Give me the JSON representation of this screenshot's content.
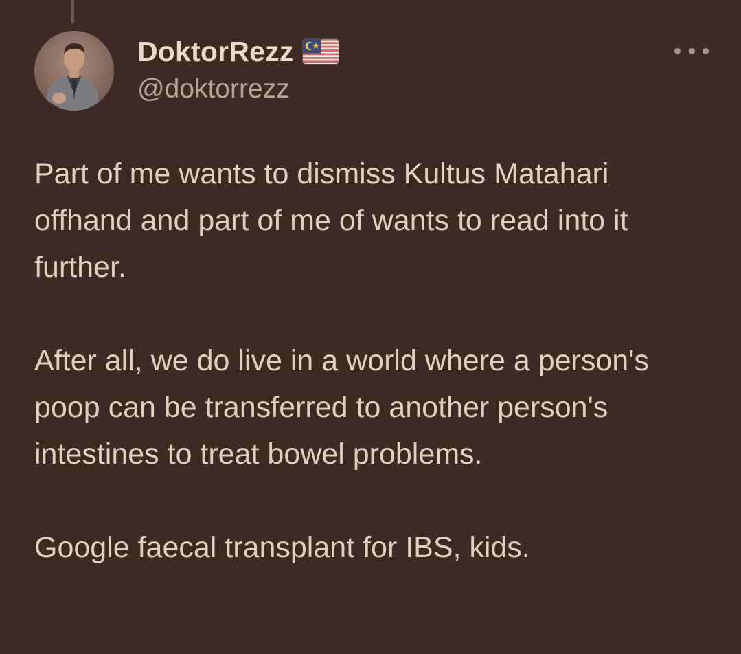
{
  "author": {
    "display_name": "DoktorRezz",
    "handle": "@doktorrezz",
    "flag_icon": "malaysia-flag-icon",
    "avatar_icon": "profile-avatar"
  },
  "actions": {
    "more_icon": "more-horizontal-icon"
  },
  "tweet": {
    "paragraphs": [
      "Part of me wants to dismiss Kultus Matahari offhand and part of me of wants to read into it further.",
      "After all, we do live in a world where a person's poop can be transferred to another person's intestines to treat bowel problems.",
      "Google faecal transplant for IBS, kids."
    ]
  },
  "colors": {
    "background": "#3e2a25",
    "text": "#e5cdbf",
    "secondary_text": "#b9a49b"
  }
}
